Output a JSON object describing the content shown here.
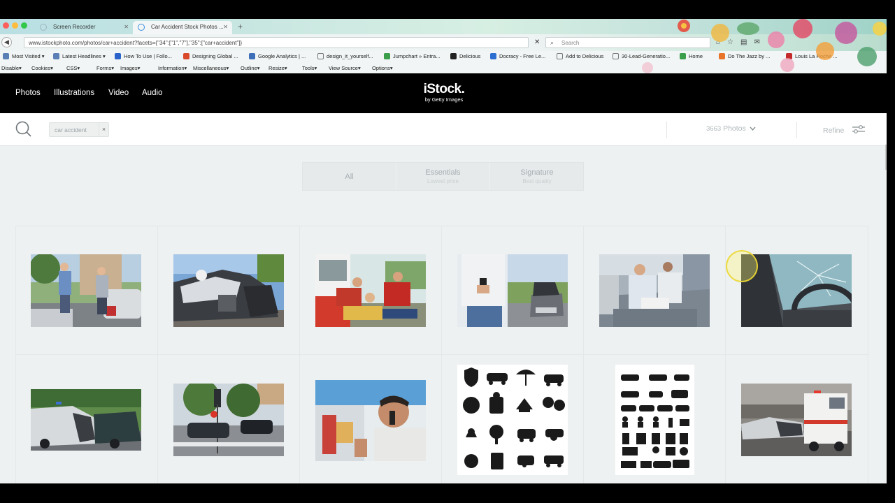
{
  "browser": {
    "tabs": [
      {
        "title": "Screen Recorder",
        "active": false
      },
      {
        "title": "Car Accident Stock Photos ...",
        "active": true
      }
    ],
    "url": "www.istockphoto.com/photos/car+accident?facets={\"34\":[\"1\",\"7\"],\"35\":[\"car+accident\"]}",
    "search_placeholder": "Search",
    "bookmarks": [
      "Most Visited ▾",
      "Latest Headlines ▾",
      "How To Use | Follo...",
      "Designing Global ...",
      "Google Analytics | ...",
      "design_it_yourself...",
      "Jumpchart » Entra...",
      "Delicious",
      "Docracy - Free Le...",
      "Add to Delicious",
      "30-Lead-Generatio...",
      "Home",
      "Do The Jazz by ...",
      "Louis La Roche ..."
    ],
    "devtools": [
      "Disable▾",
      "Cookies▾",
      "CSS▾",
      "Forms▾",
      "Images▾",
      "Information▾",
      "Miscellaneous▾",
      "Outline▾",
      "Resize▾",
      "Tools▾",
      "View Source▾",
      "Options▾"
    ]
  },
  "header": {
    "nav": [
      "Photos",
      "Illustrations",
      "Video",
      "Audio"
    ],
    "logo_main": "iStock.",
    "logo_sub": "by Getty Images"
  },
  "search": {
    "chip": "car accident",
    "chip_close": "×",
    "count": "3663",
    "count_label": "Photos",
    "refine": "Refine"
  },
  "filters": [
    {
      "title": "All",
      "subtitle": ""
    },
    {
      "title": "Essentials",
      "subtitle": "Lowest price"
    },
    {
      "title": "Signature",
      "subtitle": "Best quality"
    }
  ],
  "results": [
    {
      "kind": "photo",
      "desc": "two-men-standing-by-damaged-car"
    },
    {
      "kind": "photo",
      "desc": "wrecked-cars-pileup"
    },
    {
      "kind": "photo",
      "desc": "paramedics-helping-injured-man"
    },
    {
      "kind": "photo",
      "desc": "man-with-phone-and-broken-car"
    },
    {
      "kind": "photo",
      "desc": "couple-filling-insurance-form"
    },
    {
      "kind": "photo",
      "desc": "shattered-windshield-interior"
    },
    {
      "kind": "photo",
      "desc": "crashed-cars-on-road"
    },
    {
      "kind": "photo",
      "desc": "intersection-traffic-lights"
    },
    {
      "kind": "photo",
      "desc": "man-calling-after-accident"
    },
    {
      "kind": "illustration",
      "desc": "insurance-icon-set"
    },
    {
      "kind": "illustration",
      "desc": "car-accident-icon-set"
    },
    {
      "kind": "photo",
      "desc": "ambulance-at-crash-scene"
    }
  ],
  "colors": {
    "header_bg": "#000000",
    "page_bg": "#eef1f2",
    "muted_text": "#a6adb0"
  }
}
